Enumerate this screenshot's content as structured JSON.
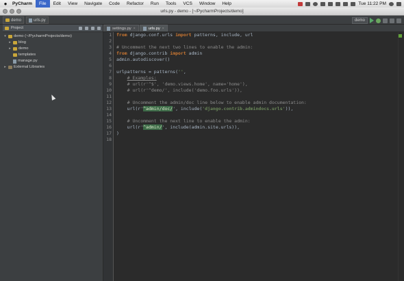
{
  "menubar": {
    "items": [
      "PyCharm",
      "File",
      "Edit",
      "View",
      "Navigate",
      "Code",
      "Refactor",
      "Run",
      "Tools",
      "VCS",
      "Window",
      "Help"
    ],
    "active": "File",
    "clock": "Tue 11:22 PM"
  },
  "window": {
    "title": "urls.py - demo - [~/PycharmProjects/demo]"
  },
  "toolbar": {
    "crumb_project": "demo",
    "crumb_file": "urls.py",
    "run_config": "demo"
  },
  "project_panel": {
    "title": "Project",
    "tree": [
      {
        "label": "demo (~/PycharmProjects/demo)",
        "indent": 0,
        "kind": "folder",
        "arrow": "▾"
      },
      {
        "label": "blog",
        "indent": 1,
        "kind": "folder",
        "arrow": "▸"
      },
      {
        "label": "demo",
        "indent": 1,
        "kind": "folder",
        "arrow": "▸"
      },
      {
        "label": "templates",
        "indent": 1,
        "kind": "folder",
        "arrow": ""
      },
      {
        "label": "manage.py",
        "indent": 1,
        "kind": "file",
        "arrow": ""
      },
      {
        "label": "External Libraries",
        "indent": 0,
        "kind": "lib",
        "arrow": "▸"
      }
    ]
  },
  "tabs": [
    {
      "label": "settings.py",
      "active": false
    },
    {
      "label": "urls.py",
      "active": true
    }
  ],
  "editor": {
    "line_numbers": [
      "1",
      "2",
      "3",
      "4",
      "5",
      "6",
      "7",
      "8",
      "9",
      "10",
      "11",
      "12",
      "13",
      "14",
      "15",
      "16",
      "17",
      "18"
    ],
    "lines": [
      [
        {
          "t": "from",
          "c": "kw"
        },
        {
          "t": " django.conf.urls ",
          "c": ""
        },
        {
          "t": "import",
          "c": "kw"
        },
        {
          "t": " patterns, include, url",
          "c": ""
        }
      ],
      [],
      [
        {
          "t": "# Uncomment the next two lines to enable the admin:",
          "c": "cm"
        }
      ],
      [
        {
          "t": "from",
          "c": "kw"
        },
        {
          "t": " django.contrib ",
          "c": ""
        },
        {
          "t": "import",
          "c": "kw"
        },
        {
          "t": " admin",
          "c": ""
        }
      ],
      [
        {
          "t": "admin.autodiscover()",
          "c": ""
        }
      ],
      [],
      [
        {
          "t": "urlpatterns = patterns(",
          "c": ""
        },
        {
          "t": "''",
          "c": "st"
        },
        {
          "t": ",",
          "c": ""
        }
      ],
      [
        {
          "t": "    ",
          "c": ""
        },
        {
          "t": "# Examples:",
          "c": "cmu"
        }
      ],
      [
        {
          "t": "    # url(r'^$', 'demo.views.home', name='home'),",
          "c": "cm"
        }
      ],
      [
        {
          "t": "    # url(r'^demo/', include('demo.foo.urls')),",
          "c": "cm"
        }
      ],
      [],
      [
        {
          "t": "    # Uncomment the admin/doc line below to enable admin documentation:",
          "c": "cm"
        }
      ],
      [
        {
          "t": "    url(r'",
          "c": ""
        },
        {
          "t": "^admin/doc/",
          "c": "hl"
        },
        {
          "t": "', include(",
          "c": ""
        },
        {
          "t": "'django.contrib.admindocs.urls'",
          "c": "st"
        },
        {
          "t": ")),",
          "c": ""
        }
      ],
      [],
      [
        {
          "t": "    # Uncomment the next line to enable the admin:",
          "c": "cm"
        }
      ],
      [
        {
          "t": "    url(r'",
          "c": ""
        },
        {
          "t": "^admin/",
          "c": "hl"
        },
        {
          "t": "', include(admin.site.urls)),",
          "c": ""
        }
      ],
      [
        {
          "t": ")",
          "c": ""
        }
      ],
      []
    ]
  },
  "colors": {
    "editor_bg": "#2b2b2b",
    "keyword": "#cc7832",
    "comment": "#8c8c8c",
    "string": "#6a8759",
    "regex_highlight": "#3d6b48",
    "inspection_ok": "#62a23a"
  }
}
